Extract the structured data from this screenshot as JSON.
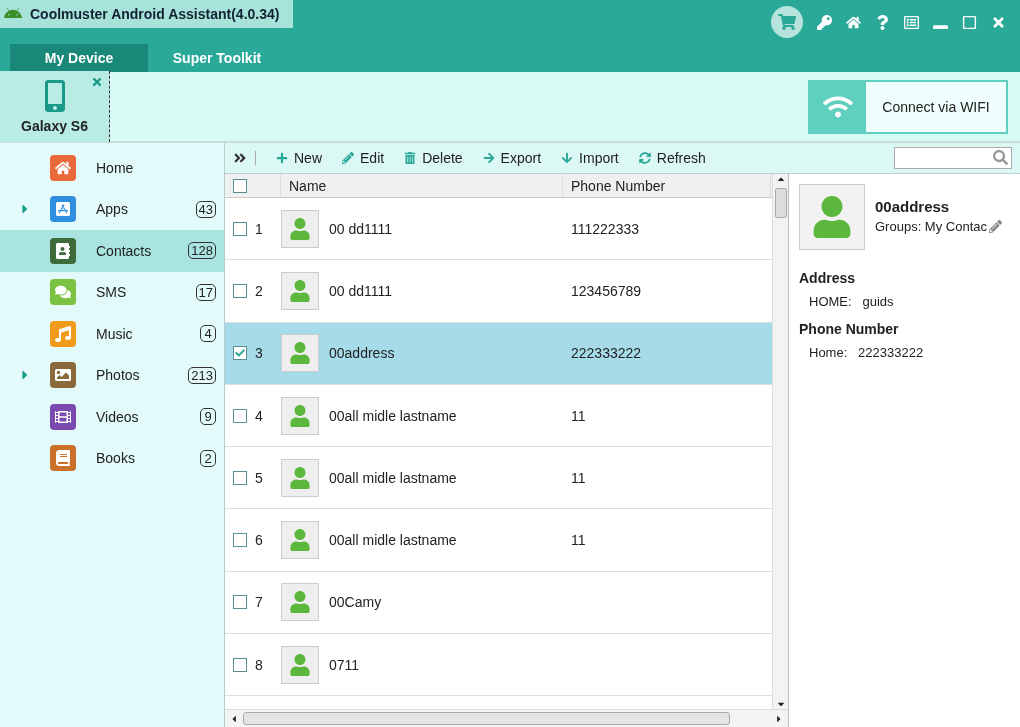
{
  "window": {
    "title": "Coolmuster Android Assistant(4.0.34)"
  },
  "tabs": [
    {
      "label": "My Device",
      "selected": true
    },
    {
      "label": "Super Toolkit",
      "selected": false
    }
  ],
  "device": {
    "name": "Galaxy S6"
  },
  "wifi_button": {
    "label": "Connect via WIFI"
  },
  "sidebar": {
    "items": [
      {
        "kind": "home",
        "label": "Home",
        "expandable": false,
        "selected": false
      },
      {
        "kind": "apps",
        "label": "Apps",
        "count": "43",
        "expandable": true,
        "selected": false
      },
      {
        "kind": "contacts",
        "label": "Contacts",
        "count": "128",
        "expandable": false,
        "selected": true
      },
      {
        "kind": "sms",
        "label": "SMS",
        "count": "17",
        "expandable": false,
        "selected": false
      },
      {
        "kind": "music",
        "label": "Music",
        "count": "4",
        "expandable": false,
        "selected": false
      },
      {
        "kind": "photos",
        "label": "Photos",
        "count": "213",
        "expandable": true,
        "selected": false
      },
      {
        "kind": "videos",
        "label": "Videos",
        "count": "9",
        "expandable": false,
        "selected": false
      },
      {
        "kind": "books",
        "label": "Books",
        "count": "2",
        "expandable": false,
        "selected": false
      }
    ]
  },
  "toolbar": [
    {
      "kind": "new",
      "label": "New"
    },
    {
      "kind": "edit",
      "label": "Edit"
    },
    {
      "kind": "delete",
      "label": "Delete"
    },
    {
      "kind": "export",
      "label": "Export"
    },
    {
      "kind": "import",
      "label": "Import"
    },
    {
      "kind": "refresh",
      "label": "Refresh"
    }
  ],
  "table": {
    "header_checked": false,
    "columns": [
      "Name",
      "Phone Number"
    ],
    "rows": [
      {
        "number": "1",
        "name": "00 dd1111",
        "phone": "111222333",
        "checked": false,
        "selected": false
      },
      {
        "number": "2",
        "name": "00 dd1111",
        "phone": "123456789",
        "checked": false,
        "selected": false
      },
      {
        "number": "3",
        "name": "00address",
        "phone": "222333222",
        "checked": true,
        "selected": true
      },
      {
        "number": "4",
        "name": "00all midle lastname",
        "phone": "11",
        "checked": false,
        "selected": false
      },
      {
        "number": "5",
        "name": "00all midle lastname",
        "phone": "11",
        "checked": false,
        "selected": false
      },
      {
        "number": "6",
        "name": "00all midle lastname",
        "phone": "11",
        "checked": false,
        "selected": false
      },
      {
        "number": "7",
        "name": "00Camy",
        "checked": false,
        "selected": false
      },
      {
        "number": "8",
        "name": "0711",
        "checked": false,
        "selected": false
      }
    ]
  },
  "detail": {
    "name": "00address",
    "groups": "Groups: My Contac",
    "sections": [
      {
        "heading": "Address",
        "entries": [
          {
            "label": "HOME:",
            "value": "guids"
          }
        ]
      },
      {
        "heading": "Phone Number",
        "entries": [
          {
            "label": "Home:",
            "value": "222333222"
          }
        ]
      }
    ]
  }
}
